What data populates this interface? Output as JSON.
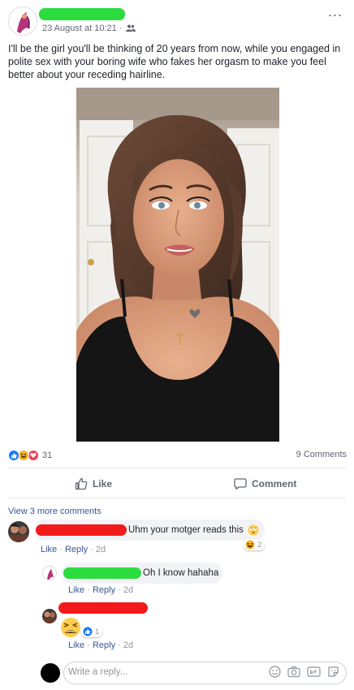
{
  "post": {
    "date": "23 August at 10:21 ·",
    "audience_icon": "friends-icon",
    "text": "I'll be the girl you'll be thinking of 20 years from now, while you engaged in polite sex with your boring wife who fakes her orgasm to make you feel better about your receding hairline.",
    "more_glyph": "..."
  },
  "reactions": {
    "types": [
      "like-icon",
      "haha-icon",
      "love-icon"
    ],
    "count": "31",
    "comments_count": "9 Comments"
  },
  "actions": {
    "like": "Like",
    "comment": "Comment"
  },
  "comments": {
    "view_more": "View 3 more comments",
    "items": [
      {
        "text": "Uhm your motger reads this",
        "emoji": "rolling-eyes-emoji",
        "badge_count": "2",
        "actions": [
          "Like",
          "Reply",
          "2d"
        ]
      },
      {
        "text": "Oh I know hahaha",
        "actions": [
          "Like",
          "Reply",
          "2d"
        ]
      },
      {
        "sticker": "tired-face-emoji",
        "badge_count": "1",
        "actions": [
          "Like",
          "Reply",
          "2d"
        ]
      }
    ]
  },
  "reply": {
    "placeholder": "Write a reply..."
  },
  "colors": {
    "redact_green": "#2bdc3f",
    "redact_red": "#f21a1a",
    "link": "#385898",
    "like_blue": "#1877f2",
    "love_red": "#f33e58",
    "haha_yellow": "#f7b125"
  }
}
